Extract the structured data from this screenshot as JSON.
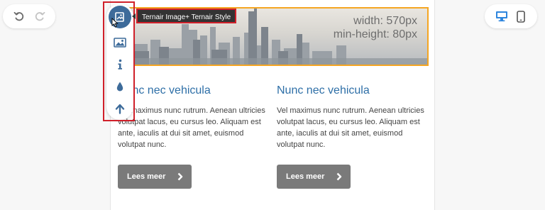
{
  "history": {
    "undo_icon": "undo-icon",
    "redo_icon": "redo-icon"
  },
  "devices": {
    "desktop_icon": "desktop-icon",
    "mobile_icon": "mobile-icon",
    "active_color": "#2e86de"
  },
  "hero": {
    "width_label": "width: 570px",
    "min_height_label": "min-height: 80px",
    "selection_color": "#f5a623"
  },
  "toolbar": {
    "items": [
      {
        "icon": "image-plus-icon",
        "active": true
      },
      {
        "icon": "image-icon"
      },
      {
        "icon": "info-icon"
      },
      {
        "icon": "drop-icon"
      },
      {
        "icon": "arrow-up-icon"
      }
    ],
    "tooltip": "Ternair Image+ Ternair Style",
    "active_color": "#3d6b9a",
    "highlight_color": "#d0202a"
  },
  "columns": [
    {
      "heading": "Nunc nec vehicula",
      "body": "Vel maximus nunc rutrum. Aenean ultricies volutpat lacus, eu cursus leo. Aliquam est ante, iaculis at dui sit amet, euismod volutpat nunc.",
      "button": "Lees meer"
    },
    {
      "heading": "Nunc nec vehicula",
      "body": "Vel maximus nunc rutrum. Aenean ultricies volutpat lacus, eu cursus leo. Aliquam est ante, iaculis at dui sit amet, euismod volutpat nunc.",
      "button": "Lees meer"
    }
  ]
}
